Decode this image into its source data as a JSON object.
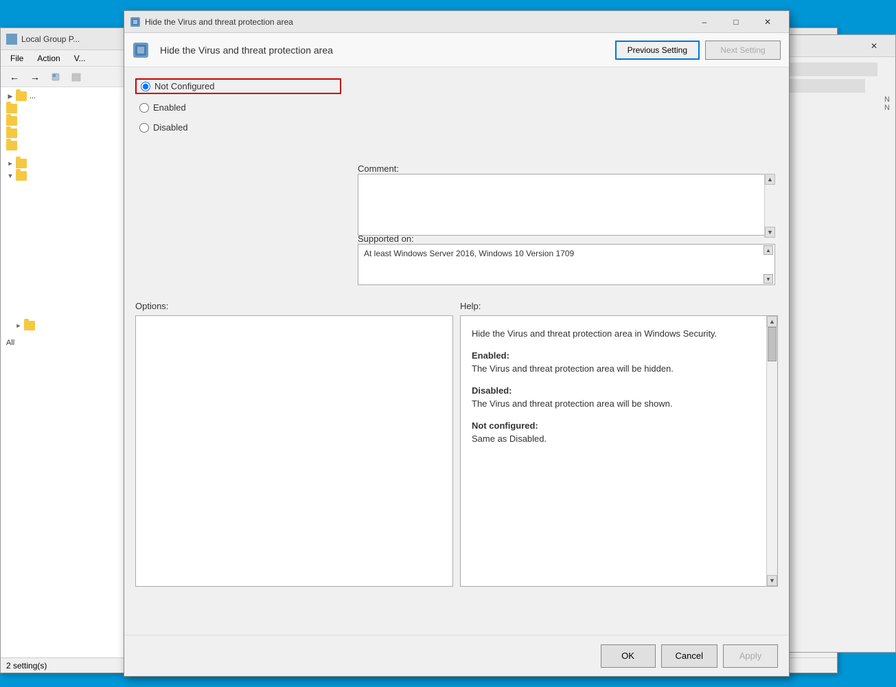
{
  "background": {
    "title": "Local Group P...",
    "menu": {
      "file": "File",
      "action": "Action",
      "view": "V..."
    },
    "statusbar": "2 setting(s)"
  },
  "dialog": {
    "titlebar_title": "Hide the Virus and threat protection area",
    "header_title": "Hide the Virus and threat protection area",
    "prev_btn": "Previous Setting",
    "next_btn": "Next Setting",
    "radio_options": {
      "not_configured": "Not Configured",
      "enabled": "Enabled",
      "disabled": "Disabled"
    },
    "comment_label": "Comment:",
    "supported_label": "Supported on:",
    "supported_value": "At least Windows Server 2016, Windows 10 Version 1709",
    "options_label": "Options:",
    "help_label": "Help:",
    "help_text_1": "Hide the Virus and threat protection area in Windows Security.",
    "help_text_2": "Enabled:",
    "help_text_3": "The Virus and threat protection area will be hidden.",
    "help_text_4": "Disabled:",
    "help_text_5": "The Virus and threat protection area will be shown.",
    "help_text_6": "Not configured:",
    "help_text_7": "Same as Disabled.",
    "ok_btn": "OK",
    "cancel_btn": "Cancel",
    "apply_btn": "Apply"
  }
}
